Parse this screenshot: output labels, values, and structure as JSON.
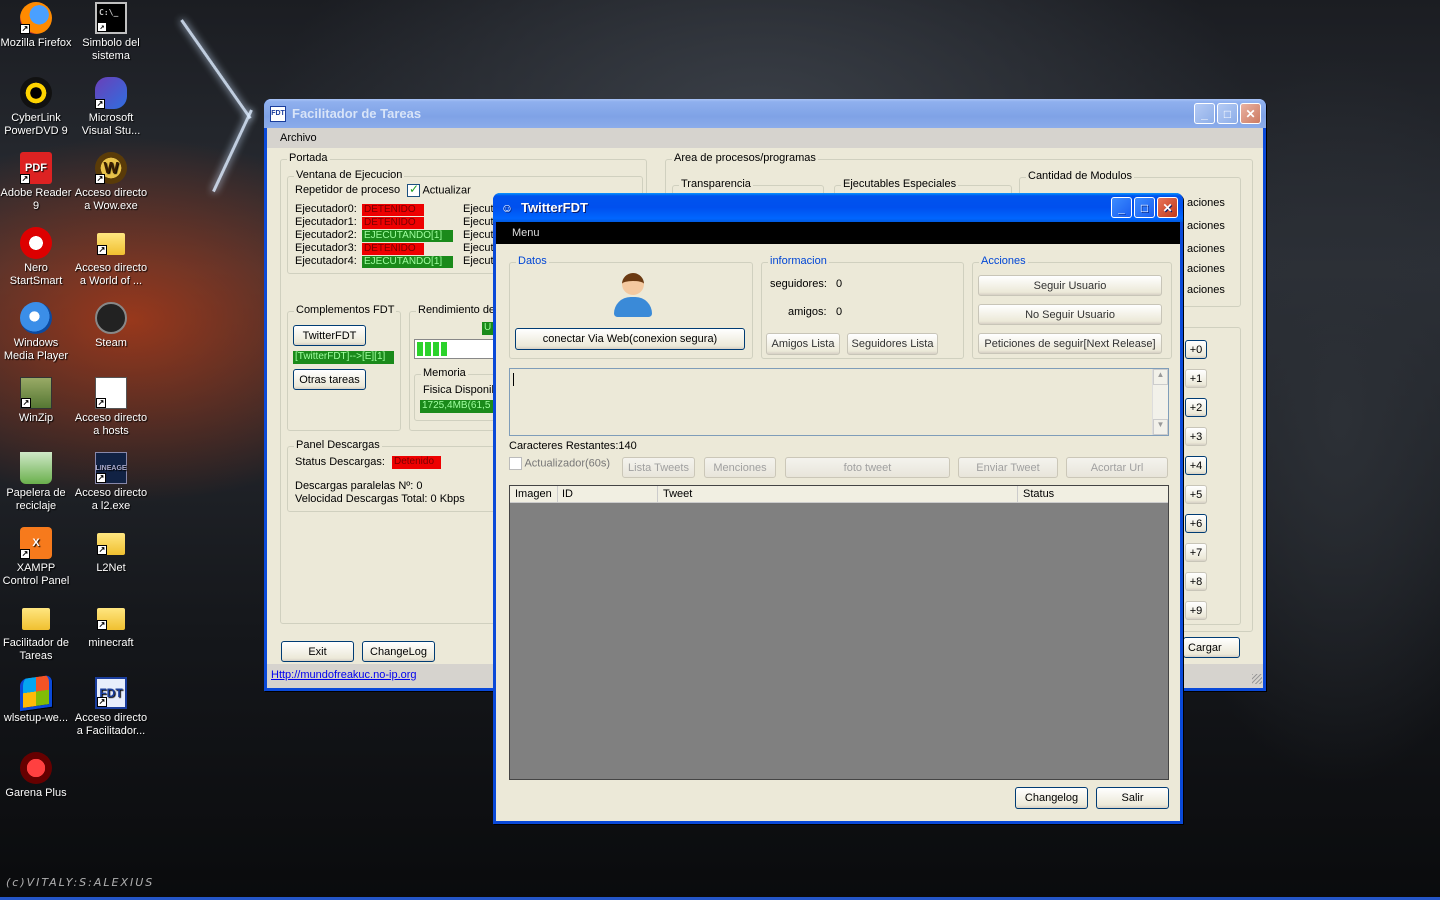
{
  "desktop": {
    "icons": [
      {
        "label": "Mozilla Firefox",
        "icon": "firefox-icon"
      },
      {
        "label": "Simbolo del sistema",
        "icon": "cmd-icon"
      },
      {
        "label": "CyberLink PowerDVD 9",
        "icon": "powerdvd-icon"
      },
      {
        "label": "Microsoft Visual Stu...",
        "icon": "visual-studio-icon"
      },
      {
        "label": "Adobe Reader 9",
        "icon": "pdf-icon"
      },
      {
        "label": "Acceso directo a Wow.exe",
        "icon": "wow-icon"
      },
      {
        "label": "Nero StartSmart",
        "icon": "nero-icon"
      },
      {
        "label": "Acceso directo a World of ...",
        "icon": "folder-icon"
      },
      {
        "label": "Windows Media Player",
        "icon": "media-player-icon"
      },
      {
        "label": "Steam",
        "icon": "steam-icon"
      },
      {
        "label": "WinZip",
        "icon": "winzip-icon"
      },
      {
        "label": "Acceso directo a hosts",
        "icon": "file-icon"
      },
      {
        "label": "Papelera de reciclaje",
        "icon": "recycle-bin-icon"
      },
      {
        "label": "Acceso directo a l2.exe",
        "icon": "l2-icon"
      },
      {
        "label": "XAMPP Control Panel",
        "icon": "xampp-icon"
      },
      {
        "label": "L2Net",
        "icon": "folder-icon"
      },
      {
        "label": "Facilitador de Tareas",
        "icon": "folder-icon"
      },
      {
        "label": "minecraft",
        "icon": "folder-icon"
      },
      {
        "label": "wlsetup-we...",
        "icon": "windows-logo-icon"
      },
      {
        "label": "Acceso directo a Facilitador...",
        "icon": "fdt-icon"
      },
      {
        "label": "Garena Plus",
        "icon": "garena-icon"
      }
    ],
    "watermark": "(c)VITALY:S:ALEXIUS"
  },
  "fdt": {
    "title": "Facilitador de Tareas",
    "menu": "Archivo",
    "portada": "Portada",
    "ventana": "Ventana de Ejecucion",
    "repetidor": "Repetidor de proceso",
    "actualizar": "Actualizar",
    "ejecutadores": [
      {
        "label": "Ejecutador0:",
        "status": "DETENIDO"
      },
      {
        "label": "Ejecutador1:",
        "status": "DETENIDO"
      },
      {
        "label": "Ejecutador2:",
        "status": "EJECUTANDO[1]"
      },
      {
        "label": "Ejecutador3:",
        "status": "DETENIDO"
      },
      {
        "label": "Ejecutador4:",
        "status": "EJECUTANDO[1]"
      }
    ],
    "ejecut_short": "Ejecut",
    "complementos": "Complementos FDT",
    "twitterfdt_btn": "TwitterFDT",
    "twitter_status": "[TwitterFDT]-->[E][1]",
    "otras_btn": "Otras tareas",
    "rendimiento": "Rendimiento del",
    "rend_badge": "U",
    "memoria": "Memoria",
    "fisica": "Fisica Disponib",
    "mem_value": "1725,4MB(61,5",
    "panel_descargas": "Panel Descargas",
    "status_descargas": "Status Descargas:",
    "detenido": "Detenido",
    "descargas_paralelas": "Descargas paralelas Nº: 0",
    "velocidad": "Velocidad Descargas Total: 0 Kbps",
    "exit_btn": "Exit",
    "changelog_btn": "ChangeLog",
    "url": "Http://mundofreakuc.no-ip.org",
    "area": "Area de procesos/programas",
    "transparencia": "Transparencia",
    "ejecutables": "Ejecutables Especiales",
    "cantidad": "Cantidad de Modulos",
    "aciones": [
      "aciones",
      "aciones",
      "aciones",
      "aciones",
      "aciones"
    ],
    "plus_buttons": [
      "+0",
      "+1",
      "+2",
      "+3",
      "+4",
      "+5",
      "+6",
      "+7",
      "+8",
      "+9"
    ],
    "cargar": "Cargar"
  },
  "twitter": {
    "title": "TwitterFDT",
    "menu": "Menu",
    "datos": "Datos",
    "conectar": "conectar Via Web(conexion segura)",
    "informacion": "informacion",
    "seguidores_label": "seguidores:",
    "seguidores_val": "0",
    "amigos_label": "amigos:",
    "amigos_val": "0",
    "amigos_lista": "Amigos Lista",
    "seguidores_lista": "Seguidores Lista",
    "acciones": "Acciones",
    "seguir": "Seguir Usuario",
    "no_seguir": "No Seguir Usuario",
    "peticiones": "Peticiones de seguir[Next Release]",
    "tweet_text": "",
    "caracteres": "Caracteres Restantes:140",
    "actualizador": "Actualizador(60s)",
    "lista_tweets": "Lista Tweets",
    "menciones": "Menciones",
    "foto_tweet": "foto tweet",
    "enviar_tweet": "Enviar Tweet",
    "acortar_url": "Acortar Url",
    "columns": [
      "Imagen",
      "ID",
      "Tweet",
      "Status"
    ],
    "changelog": "Changelog",
    "salir": "Salir"
  }
}
